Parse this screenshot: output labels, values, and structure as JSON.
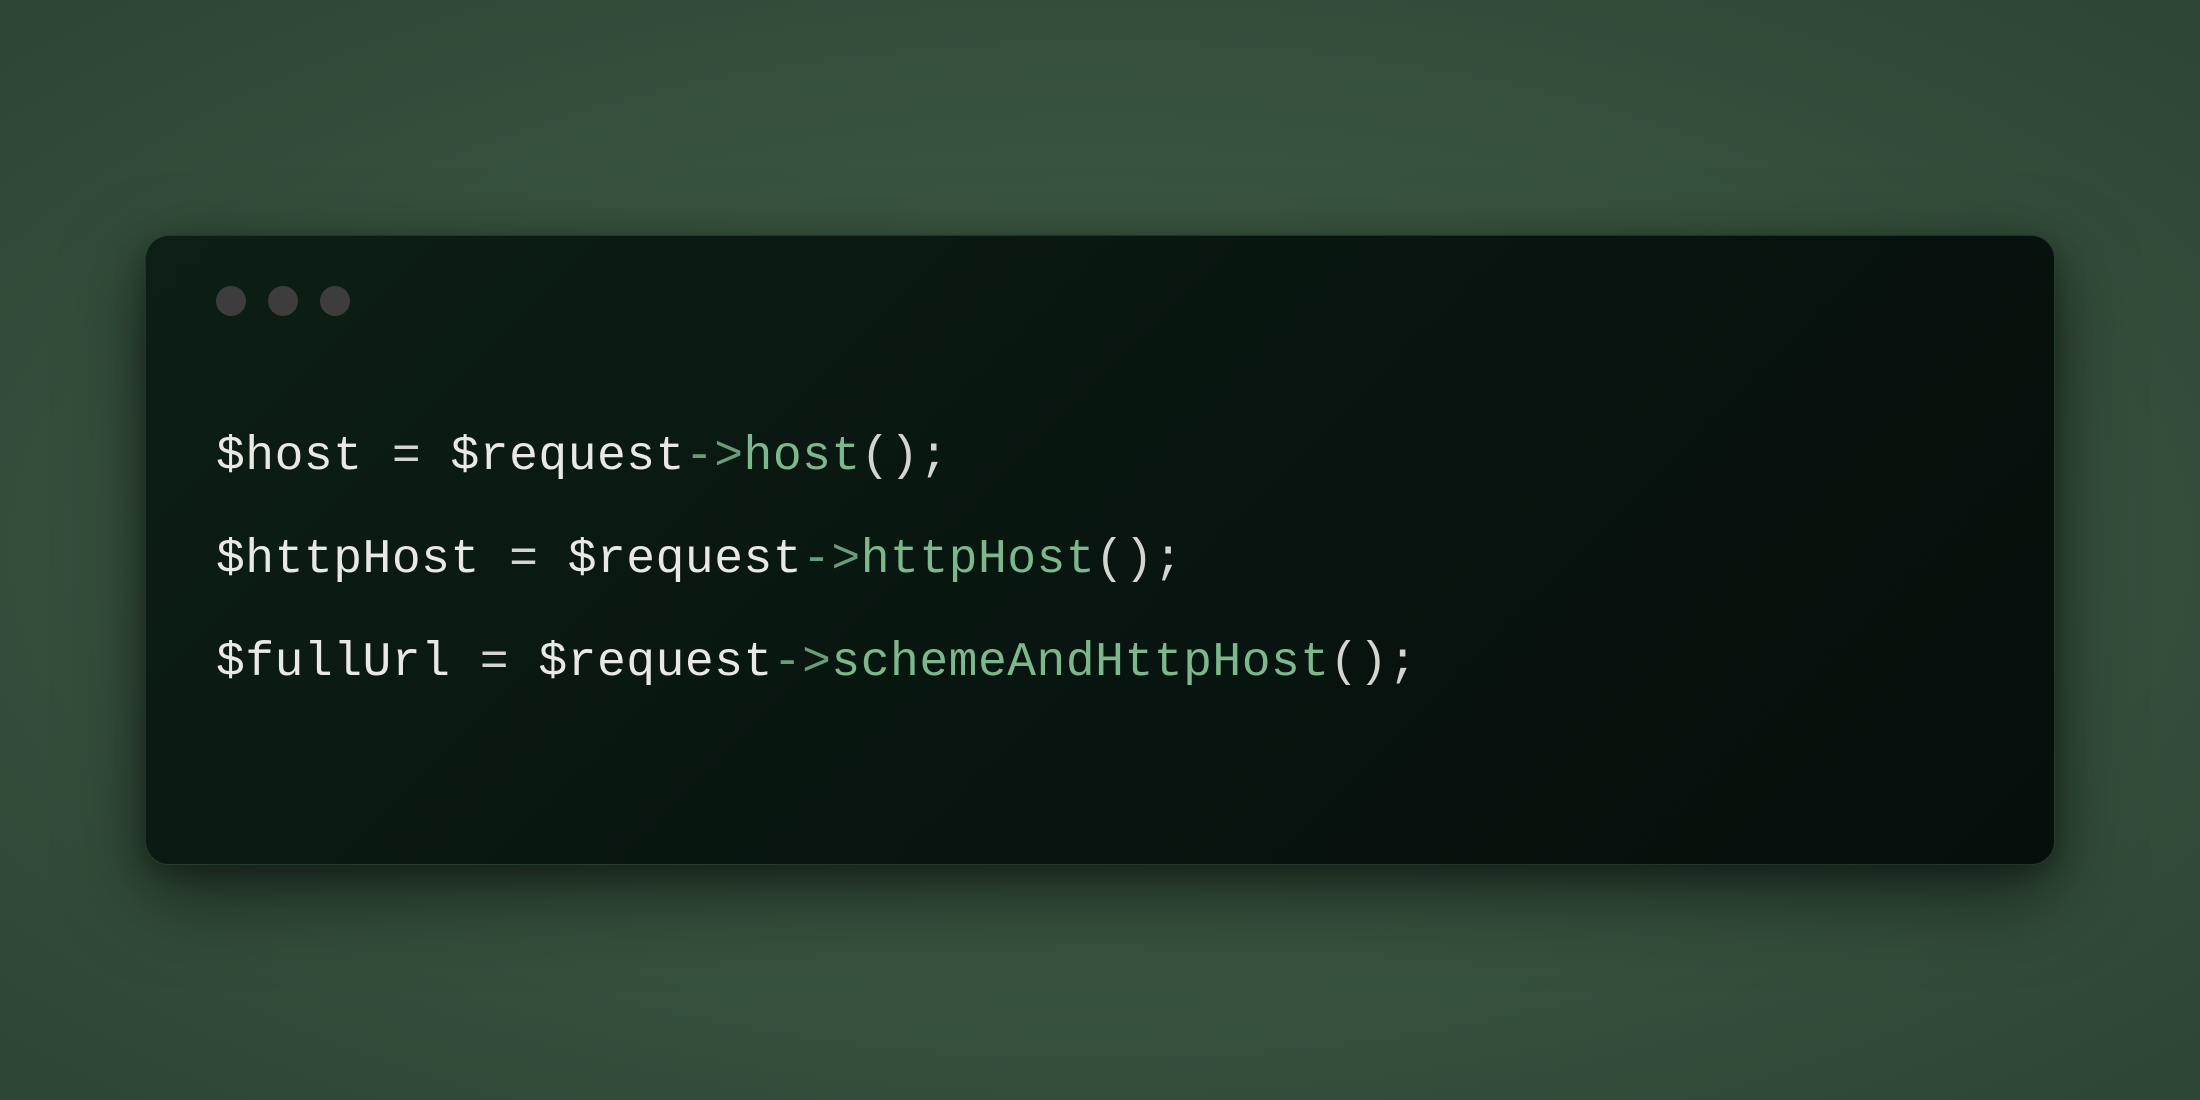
{
  "code": {
    "lines": [
      {
        "tokens": [
          {
            "type": "variable",
            "text": "$host"
          },
          {
            "type": "space",
            "text": " "
          },
          {
            "type": "operator",
            "text": "="
          },
          {
            "type": "space",
            "text": " "
          },
          {
            "type": "variable",
            "text": "$request"
          },
          {
            "type": "arrow",
            "text": "->"
          },
          {
            "type": "method",
            "text": "host"
          },
          {
            "type": "paren",
            "text": "()"
          },
          {
            "type": "semicolon",
            "text": ";"
          }
        ]
      },
      {
        "tokens": [
          {
            "type": "variable",
            "text": "$httpHost"
          },
          {
            "type": "space",
            "text": " "
          },
          {
            "type": "operator",
            "text": "="
          },
          {
            "type": "space",
            "text": " "
          },
          {
            "type": "variable",
            "text": "$request"
          },
          {
            "type": "arrow",
            "text": "->"
          },
          {
            "type": "method",
            "text": "httpHost"
          },
          {
            "type": "paren",
            "text": "()"
          },
          {
            "type": "semicolon",
            "text": ";"
          }
        ]
      },
      {
        "tokens": [
          {
            "type": "variable",
            "text": "$fullUrl"
          },
          {
            "type": "space",
            "text": " "
          },
          {
            "type": "operator",
            "text": "="
          },
          {
            "type": "space",
            "text": " "
          },
          {
            "type": "variable",
            "text": "$request"
          },
          {
            "type": "arrow",
            "text": "->"
          },
          {
            "type": "method",
            "text": "schemeAndHttpHost"
          },
          {
            "type": "paren",
            "text": "()"
          },
          {
            "type": "semicolon",
            "text": ";"
          }
        ]
      }
    ]
  }
}
